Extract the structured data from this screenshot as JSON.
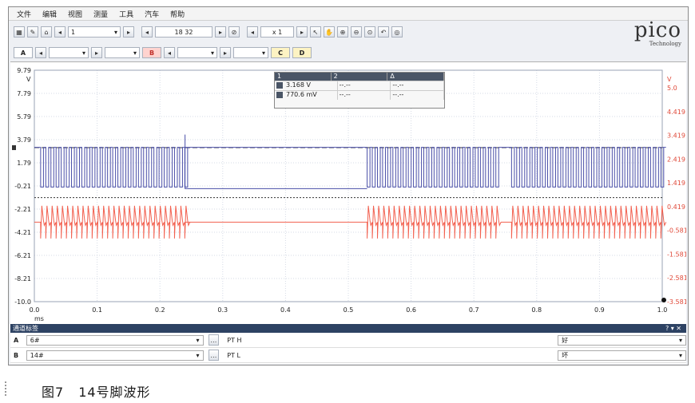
{
  "menu": {
    "items": [
      "文件",
      "编辑",
      "视图",
      "测量",
      "工具",
      "汽车",
      "帮助"
    ]
  },
  "toolbar": {
    "buffer_value": "1",
    "timebase_value": "18 32",
    "zoom_value": "x 1",
    "logo_text": "pico",
    "logo_sub": "Technology"
  },
  "channels_bar": {
    "a_label": "A",
    "b_label": "B",
    "c_label": "C",
    "d_label": "D"
  },
  "cursor_table": {
    "headers": [
      "1",
      "2",
      "Δ"
    ],
    "rows": [
      [
        "3.168 V",
        "--.--",
        "--.--"
      ],
      [
        "770.6 mV",
        "--.--",
        "--.--"
      ]
    ]
  },
  "chart_data": {
    "type": "line",
    "xlabel": "ms",
    "xlim": [
      0.0,
      1.0
    ],
    "x_ticks": [
      "0.0",
      "0.1",
      "0.2",
      "0.3",
      "0.4",
      "0.5",
      "0.6",
      "0.7",
      "0.8",
      "0.9",
      "1.0"
    ],
    "left_axis": {
      "unit": "V",
      "ylim": [
        -10.0,
        9.79
      ],
      "ticks": [
        "9.79",
        "7.79",
        "5.79",
        "3.79",
        "1.79",
        "-0.21",
        "-2.21",
        "-4.21",
        "-6.21",
        "-8.21",
        "-10.0"
      ]
    },
    "right_axis": {
      "unit": "V",
      "ticks": [
        "5.0",
        "4.419",
        "3.419",
        "2.419",
        "1.419",
        "0.419",
        "-0.581",
        "-1.581",
        "-2.581",
        "-3.581"
      ]
    },
    "series": [
      {
        "channel": "A",
        "color": "#4a4fa8",
        "high_level": 3.2,
        "low_level": -0.2,
        "bursts_ms": [
          [
            0.01,
            0.24
          ],
          [
            0.53,
            0.74
          ],
          [
            0.76,
            1.0
          ]
        ],
        "idle_ms": [
          [
            0.24,
            0.53
          ]
        ]
      },
      {
        "channel": "B",
        "color": "#f2604f",
        "high_level": -1.8,
        "low_level": -4.6,
        "bursts_ms": [
          [
            0.01,
            0.24
          ],
          [
            0.53,
            0.74
          ],
          [
            0.76,
            1.0
          ]
        ],
        "idle_ms": [
          [
            0.24,
            0.53
          ]
        ]
      }
    ],
    "trigger_levels": {
      "A": 3.168,
      "B": 0.77
    }
  },
  "channel_panel": {
    "title": "通道标签",
    "rows": [
      {
        "channel": "A",
        "probe": "6#",
        "name": "PT H",
        "status": "好"
      },
      {
        "channel": "B",
        "probe": "14#",
        "name": "PT L",
        "status": "坏"
      }
    ]
  },
  "caption": {
    "figure": "图7",
    "text": "14号脚波形"
  }
}
